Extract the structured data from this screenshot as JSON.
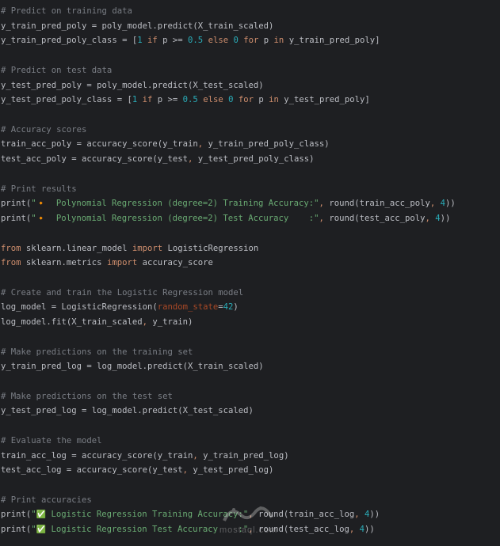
{
  "colors": {
    "background": "#1e1f22",
    "comment": "#7a7e85",
    "keyword": "#cf8e6d",
    "number": "#2aacb8",
    "string": "#6aab73",
    "parameter": "#aa4926",
    "default": "#bcbec4"
  },
  "icons": {
    "bullet": "diamond-icon",
    "check": "check-mark-icon"
  },
  "watermark": {
    "brand": "mostaql",
    "text": "mostaql.com"
  },
  "code_lines": [
    [
      {
        "t": "comment",
        "v": "# Predict on training data"
      }
    ],
    [
      {
        "t": "plain",
        "v": "y_train_pred_poly = poly_model.predict(X_train_scaled)"
      }
    ],
    [
      {
        "t": "plain",
        "v": "y_train_pred_poly_class = ["
      },
      {
        "t": "num",
        "v": "1"
      },
      {
        "t": "plain",
        "v": " "
      },
      {
        "t": "kw",
        "v": "if"
      },
      {
        "t": "plain",
        "v": " p >= "
      },
      {
        "t": "num",
        "v": "0.5"
      },
      {
        "t": "plain",
        "v": " "
      },
      {
        "t": "kw",
        "v": "else"
      },
      {
        "t": "plain",
        "v": " "
      },
      {
        "t": "num",
        "v": "0"
      },
      {
        "t": "plain",
        "v": " "
      },
      {
        "t": "kw",
        "v": "for"
      },
      {
        "t": "plain",
        "v": " p "
      },
      {
        "t": "kw",
        "v": "in"
      },
      {
        "t": "plain",
        "v": " y_train_pred_poly]"
      }
    ],
    [],
    [
      {
        "t": "comment",
        "v": "# Predict on test data"
      }
    ],
    [
      {
        "t": "plain",
        "v": "y_test_pred_poly = poly_model.predict(X_test_scaled)"
      }
    ],
    [
      {
        "t": "plain",
        "v": "y_test_pred_poly_class = ["
      },
      {
        "t": "num",
        "v": "1"
      },
      {
        "t": "plain",
        "v": " "
      },
      {
        "t": "kw",
        "v": "if"
      },
      {
        "t": "plain",
        "v": " p >= "
      },
      {
        "t": "num",
        "v": "0.5"
      },
      {
        "t": "plain",
        "v": " "
      },
      {
        "t": "kw",
        "v": "else"
      },
      {
        "t": "plain",
        "v": " "
      },
      {
        "t": "num",
        "v": "0"
      },
      {
        "t": "plain",
        "v": " "
      },
      {
        "t": "kw",
        "v": "for"
      },
      {
        "t": "plain",
        "v": " p "
      },
      {
        "t": "kw",
        "v": "in"
      },
      {
        "t": "plain",
        "v": " y_test_pred_poly]"
      }
    ],
    [],
    [
      {
        "t": "comment",
        "v": "# Accuracy scores"
      }
    ],
    [
      {
        "t": "plain",
        "v": "train_acc_poly = accuracy_score(y_train"
      },
      {
        "t": "kw",
        "v": ","
      },
      {
        "t": "plain",
        "v": " y_train_pred_poly_class)"
      }
    ],
    [
      {
        "t": "plain",
        "v": "test_acc_poly = accuracy_score(y_test"
      },
      {
        "t": "kw",
        "v": ","
      },
      {
        "t": "plain",
        "v": " y_test_pred_poly_class)"
      }
    ],
    [],
    [
      {
        "t": "comment",
        "v": "# Print results"
      }
    ],
    [
      {
        "t": "plain",
        "v": "print("
      },
      {
        "t": "str",
        "v": "\""
      },
      {
        "t": "icon",
        "v": "🔸",
        "icon": "diamond-icon"
      },
      {
        "t": "str",
        "v": "  Polynomial Regression (degree=2) Training Accuracy:\""
      },
      {
        "t": "kw",
        "v": ","
      },
      {
        "t": "plain",
        "v": " round(train_acc_poly"
      },
      {
        "t": "kw",
        "v": ","
      },
      {
        "t": "plain",
        "v": " "
      },
      {
        "t": "num",
        "v": "4"
      },
      {
        "t": "plain",
        "v": "))"
      }
    ],
    [
      {
        "t": "plain",
        "v": "print("
      },
      {
        "t": "str",
        "v": "\""
      },
      {
        "t": "icon",
        "v": "🔸",
        "icon": "diamond-icon"
      },
      {
        "t": "str",
        "v": "  Polynomial Regression (degree=2) Test Accuracy    :\""
      },
      {
        "t": "kw",
        "v": ","
      },
      {
        "t": "plain",
        "v": " round(test_acc_poly"
      },
      {
        "t": "kw",
        "v": ","
      },
      {
        "t": "plain",
        "v": " "
      },
      {
        "t": "num",
        "v": "4"
      },
      {
        "t": "plain",
        "v": "))"
      }
    ],
    [],
    [
      {
        "t": "kw",
        "v": "from"
      },
      {
        "t": "plain",
        "v": " sklearn.linear_model "
      },
      {
        "t": "kw",
        "v": "import"
      },
      {
        "t": "plain",
        "v": " LogisticRegression"
      }
    ],
    [
      {
        "t": "kw",
        "v": "from"
      },
      {
        "t": "plain",
        "v": " sklearn.metrics "
      },
      {
        "t": "kw",
        "v": "import"
      },
      {
        "t": "plain",
        "v": " accuracy_score"
      }
    ],
    [],
    [
      {
        "t": "comment",
        "v": "# Create and train the Logistic Regression model"
      }
    ],
    [
      {
        "t": "plain",
        "v": "log_model = LogisticRegression("
      },
      {
        "t": "param",
        "v": "random_state"
      },
      {
        "t": "plain",
        "v": "="
      },
      {
        "t": "num",
        "v": "42"
      },
      {
        "t": "plain",
        "v": ")"
      }
    ],
    [
      {
        "t": "plain",
        "v": "log_model.fit(X_train_scaled"
      },
      {
        "t": "kw",
        "v": ","
      },
      {
        "t": "plain",
        "v": " y_train)"
      }
    ],
    [],
    [
      {
        "t": "comment",
        "v": "# Make predictions on the training set"
      }
    ],
    [
      {
        "t": "plain",
        "v": "y_train_pred_log = log_model.predict(X_train_scaled)"
      }
    ],
    [],
    [
      {
        "t": "comment",
        "v": "# Make predictions on the test set"
      }
    ],
    [
      {
        "t": "plain",
        "v": "y_test_pred_log = log_model.predict(X_test_scaled)"
      }
    ],
    [],
    [
      {
        "t": "comment",
        "v": "# Evaluate the model"
      }
    ],
    [
      {
        "t": "plain",
        "v": "train_acc_log = accuracy_score(y_train"
      },
      {
        "t": "kw",
        "v": ","
      },
      {
        "t": "plain",
        "v": " y_train_pred_log)"
      }
    ],
    [
      {
        "t": "plain",
        "v": "test_acc_log = accuracy_score(y_test"
      },
      {
        "t": "kw",
        "v": ","
      },
      {
        "t": "plain",
        "v": " y_test_pred_log)"
      }
    ],
    [],
    [
      {
        "t": "comment",
        "v": "# Print accuracies"
      }
    ],
    [
      {
        "t": "plain",
        "v": "print("
      },
      {
        "t": "str",
        "v": "\""
      },
      {
        "t": "icon",
        "v": "✅",
        "icon": "check-mark-icon"
      },
      {
        "t": "str",
        "v": " Logistic Regression Training Accuracy:\""
      },
      {
        "t": "kw",
        "v": ","
      },
      {
        "t": "plain",
        "v": " round(train_acc_log"
      },
      {
        "t": "kw",
        "v": ","
      },
      {
        "t": "plain",
        "v": " "
      },
      {
        "t": "num",
        "v": "4"
      },
      {
        "t": "plain",
        "v": "))"
      }
    ],
    [
      {
        "t": "plain",
        "v": "print("
      },
      {
        "t": "str",
        "v": "\""
      },
      {
        "t": "icon",
        "v": "✅",
        "icon": "check-mark-icon"
      },
      {
        "t": "str",
        "v": " Logistic Regression Test Accuracy    :\""
      },
      {
        "t": "kw",
        "v": ","
      },
      {
        "t": "plain",
        "v": " round(test_acc_log"
      },
      {
        "t": "kw",
        "v": ","
      },
      {
        "t": "plain",
        "v": " "
      },
      {
        "t": "num",
        "v": "4"
      },
      {
        "t": "plain",
        "v": "))"
      }
    ]
  ]
}
